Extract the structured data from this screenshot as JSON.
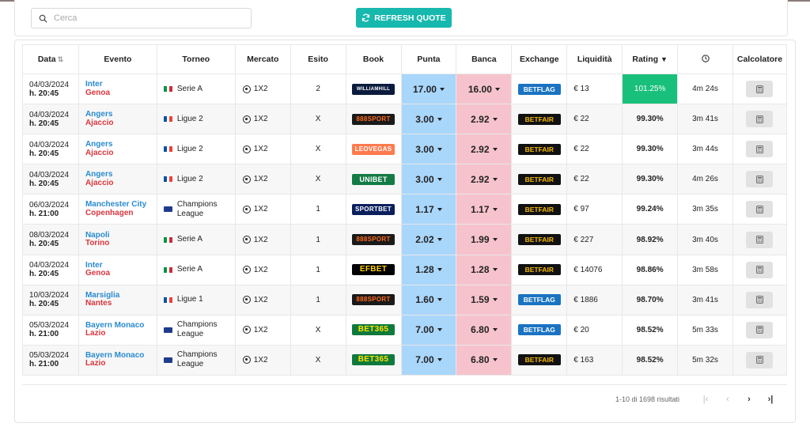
{
  "search": {
    "placeholder": "Cerca"
  },
  "refresh_label": "REFRESH QUOTE",
  "headers": {
    "data": "Data",
    "evento": "Evento",
    "torneo": "Torneo",
    "mercato": "Mercato",
    "esito": "Esito",
    "book": "Book",
    "punta": "Punta",
    "banca": "Banca",
    "exchange": "Exchange",
    "liquidita": "Liquidità",
    "rating": "Rating",
    "calcolatore": "Calcolatore"
  },
  "colors": {
    "accent": "#17b8ad",
    "punta": "#a9d6fb",
    "banca": "#f6c3cc",
    "best_rating": "#19c07b",
    "home_team": "#2a8bd0",
    "away_team": "#d9363e"
  },
  "rows": [
    {
      "date": "04/03/2024",
      "time": "h. 20:45",
      "home": "Inter",
      "away": "Genoa",
      "flag": "it",
      "torneo": [
        "Serie A"
      ],
      "mercato": "1X2",
      "esito": "2",
      "book": "WILLIAMHILL",
      "punta": "17.00",
      "banca": "16.00",
      "exchange": "BETFLAG",
      "liquidita": "€ 13",
      "rating": "101.25%",
      "updated": "4m 24s"
    },
    {
      "date": "04/03/2024",
      "time": "h. 20:45",
      "home": "Angers",
      "away": "Ajaccio",
      "flag": "fr",
      "torneo": [
        "Ligue 2"
      ],
      "mercato": "1X2",
      "esito": "X",
      "book": "888SPORT",
      "punta": "3.00",
      "banca": "2.92",
      "exchange": "BETFAIR",
      "liquidita": "€ 22",
      "rating": "99.30%",
      "updated": "3m 41s"
    },
    {
      "date": "04/03/2024",
      "time": "h. 20:45",
      "home": "Angers",
      "away": "Ajaccio",
      "flag": "fr",
      "torneo": [
        "Ligue 2"
      ],
      "mercato": "1X2",
      "esito": "X",
      "book": "LEOVEGAS",
      "punta": "3.00",
      "banca": "2.92",
      "exchange": "BETFAIR",
      "liquidita": "€ 22",
      "rating": "99.30%",
      "updated": "3m 44s"
    },
    {
      "date": "04/03/2024",
      "time": "h. 20:45",
      "home": "Angers",
      "away": "Ajaccio",
      "flag": "fr",
      "torneo": [
        "Ligue 2"
      ],
      "mercato": "1X2",
      "esito": "X",
      "book": "UNIBET",
      "punta": "3.00",
      "banca": "2.92",
      "exchange": "BETFAIR",
      "liquidita": "€ 22",
      "rating": "99.30%",
      "updated": "4m 26s"
    },
    {
      "date": "06/03/2024",
      "time": "h. 21:00",
      "home": "Manchester City",
      "away": "Copenhagen",
      "flag": "eu",
      "torneo": [
        "Champions",
        "League"
      ],
      "mercato": "1X2",
      "esito": "1",
      "book": "SPORTBET",
      "punta": "1.17",
      "banca": "1.17",
      "exchange": "BETFAIR",
      "liquidita": "€ 97",
      "rating": "99.24%",
      "updated": "3m 35s"
    },
    {
      "date": "08/03/2024",
      "time": "h. 20:45",
      "home": "Napoli",
      "away": "Torino",
      "flag": "it",
      "torneo": [
        "Serie A"
      ],
      "mercato": "1X2",
      "esito": "1",
      "book": "888SPORT",
      "punta": "2.02",
      "banca": "1.99",
      "exchange": "BETFAIR",
      "liquidita": "€ 227",
      "rating": "98.92%",
      "updated": "3m 40s"
    },
    {
      "date": "04/03/2024",
      "time": "h. 20:45",
      "home": "Inter",
      "away": "Genoa",
      "flag": "it",
      "torneo": [
        "Serie A"
      ],
      "mercato": "1X2",
      "esito": "1",
      "book": "EFBET",
      "punta": "1.28",
      "banca": "1.28",
      "exchange": "BETFAIR",
      "liquidita": "€ 14076",
      "rating": "98.86%",
      "updated": "3m 58s"
    },
    {
      "date": "10/03/2024",
      "time": "h. 20:45",
      "home": "Marsiglia",
      "away": "Nantes",
      "flag": "fr",
      "torneo": [
        "Ligue 1"
      ],
      "mercato": "1X2",
      "esito": "1",
      "book": "888SPORT",
      "punta": "1.60",
      "banca": "1.59",
      "exchange": "BETFLAG",
      "liquidita": "€ 1886",
      "rating": "98.70%",
      "updated": "3m 41s"
    },
    {
      "date": "05/03/2024",
      "time": "h. 21:00",
      "home": "Bayern Monaco",
      "away": "Lazio",
      "flag": "eu",
      "torneo": [
        "Champions",
        "League"
      ],
      "mercato": "1X2",
      "esito": "X",
      "book": "BET365",
      "punta": "7.00",
      "banca": "6.80",
      "exchange": "BETFLAG",
      "liquidita": "€ 20",
      "rating": "98.52%",
      "updated": "5m 33s"
    },
    {
      "date": "05/03/2024",
      "time": "h. 21:00",
      "home": "Bayern Monaco",
      "away": "Lazio",
      "flag": "eu",
      "torneo": [
        "Champions",
        "League"
      ],
      "mercato": "1X2",
      "esito": "X",
      "book": "BET365",
      "punta": "7.00",
      "banca": "6.80",
      "exchange": "BETFAIR",
      "liquidita": "€ 163",
      "rating": "98.52%",
      "updated": "5m 32s"
    }
  ],
  "pagination": {
    "summary": "1-10 di 1698 risultati"
  },
  "icons": {
    "search": "search-icon",
    "refresh": "refresh-icon",
    "clock": "clock-icon",
    "calculator": "calculator-icon",
    "first": "first-page-icon",
    "prev": "prev-page-icon",
    "next": "next-page-icon",
    "last": "last-page-icon"
  }
}
